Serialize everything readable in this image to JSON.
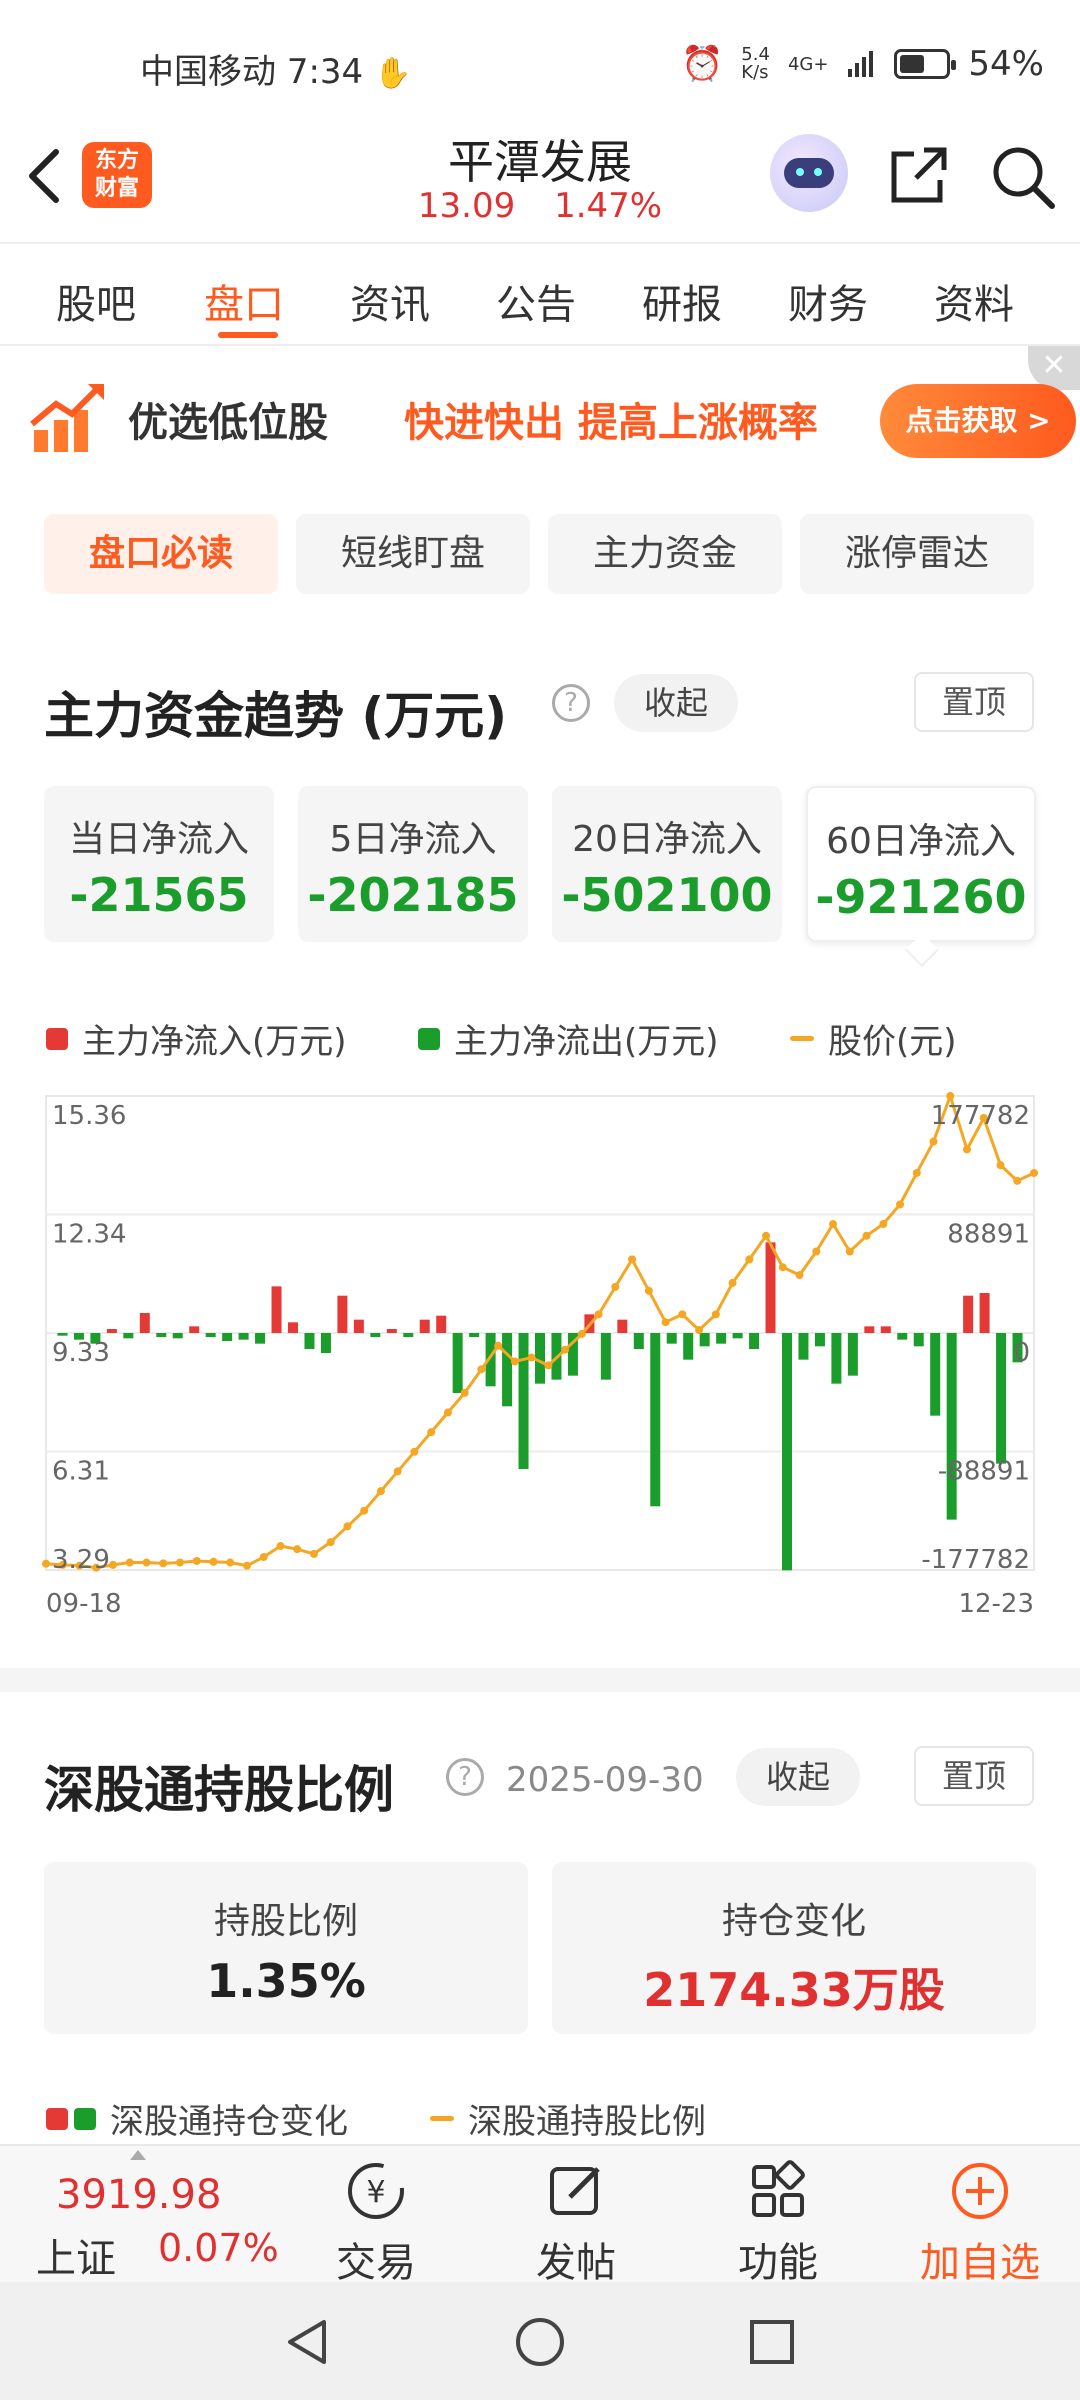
{
  "status": {
    "carrier": "中国移动",
    "time": "7:34",
    "net_speed": "5.4\nK/s",
    "net_type": "4G+",
    "battery": "54%",
    "battery_level": 0.54
  },
  "header": {
    "logo_text_1": "东方",
    "logo_text_2": "财富",
    "stock_name": "平潭发展",
    "price": "13.09",
    "change_pct": "1.47%"
  },
  "tabs": [
    "股吧",
    "盘口",
    "资讯",
    "公告",
    "研报",
    "财务",
    "资料"
  ],
  "active_tab": 1,
  "banner": {
    "title": "优选低位股",
    "slogan": "快进快出 提高上涨概率",
    "button": "点击获取 >"
  },
  "subtabs": [
    "盘口必读",
    "短线盯盘",
    "主力资金",
    "涨停雷达"
  ],
  "flow_section": {
    "title": "主力资金趋势 (万元)",
    "collapse": "收起",
    "pin": "置顶",
    "cards": [
      {
        "label": "当日净流入",
        "value": "-21565"
      },
      {
        "label": "5日净流入",
        "value": "-202185"
      },
      {
        "label": "20日净流入",
        "value": "-502100"
      },
      {
        "label": "60日净流入",
        "value": "-921260"
      }
    ],
    "legend": {
      "inflow": "主力净流入(万元)",
      "outflow": "主力净流出(万元)",
      "price": "股价(元)"
    }
  },
  "chart_data": {
    "type": "bar",
    "x_start_label": "09-18",
    "x_end_label": "12-23",
    "left_axis_ticks": [
      "15.36",
      "12.34",
      "9.33",
      "6.31",
      "3.29"
    ],
    "right_axis_ticks": [
      "177782",
      "88891",
      "0",
      "-88891",
      "-177782"
    ],
    "price_ylim": [
      3.29,
      15.36
    ],
    "flow_ylim": [
      -177782,
      177782
    ],
    "colors": {
      "inflow": "#e53935",
      "outflow": "#1a9d2a",
      "price": "#f5a623"
    },
    "series": [
      {
        "name": "主力净流入(万元)/主力净流出(万元)",
        "values": [
          -2000,
          -5000,
          -8000,
          3000,
          -4000,
          15000,
          -3000,
          -4000,
          5000,
          -3000,
          -6000,
          -5000,
          -8000,
          35000,
          8000,
          -12000,
          -15000,
          28000,
          10000,
          -3000,
          3000,
          -3000,
          10000,
          13000,
          -45000,
          -3000,
          -40000,
          -55000,
          -102000,
          -38000,
          -35000,
          -32000,
          14000,
          -35000,
          10000,
          -12000,
          -130000,
          -8000,
          -20000,
          -10000,
          -8000,
          -4000,
          -12000,
          68000,
          -178000,
          -20000,
          -10000,
          -38000,
          -32000,
          5000,
          5000,
          -5000,
          -10000,
          -62000,
          -140000,
          28000,
          30000,
          -98000,
          -22000
        ],
        "note_units": "万元"
      },
      {
        "name": "股价(元)",
        "values": [
          3.45,
          3.42,
          3.4,
          3.35,
          3.42,
          3.48,
          3.48,
          3.46,
          3.48,
          3.52,
          3.5,
          3.48,
          3.4,
          3.62,
          3.9,
          3.82,
          3.7,
          4.0,
          4.4,
          4.8,
          5.3,
          5.8,
          6.3,
          6.8,
          7.3,
          7.8,
          8.4,
          9.0,
          8.6,
          8.7,
          8.5,
          8.9,
          9.3,
          9.8,
          10.5,
          11.2,
          10.4,
          9.6,
          9.8,
          9.4,
          9.8,
          10.6,
          11.2,
          11.8,
          11.0,
          10.8,
          11.4,
          12.1,
          11.4,
          11.8,
          12.1,
          12.6,
          13.4,
          14.2,
          15.36,
          14.0,
          14.8,
          13.6,
          13.2,
          13.4
        ]
      }
    ]
  },
  "hk_section": {
    "title": "深股通持股比例",
    "date": "2025-09-30",
    "collapse": "收起",
    "pin": "置顶",
    "cards": [
      {
        "label": "持股比例",
        "value": "1.35%"
      },
      {
        "label": "持仓变化",
        "value": "2174.33万股"
      }
    ],
    "legend_change": "深股通持仓变化",
    "legend_ratio": "深股通持股比例"
  },
  "bottom": {
    "index_value": "3919.98",
    "index_name": "上证",
    "index_pct": "0.07%",
    "items": [
      "交易",
      "发帖",
      "功能",
      "加自选"
    ]
  }
}
